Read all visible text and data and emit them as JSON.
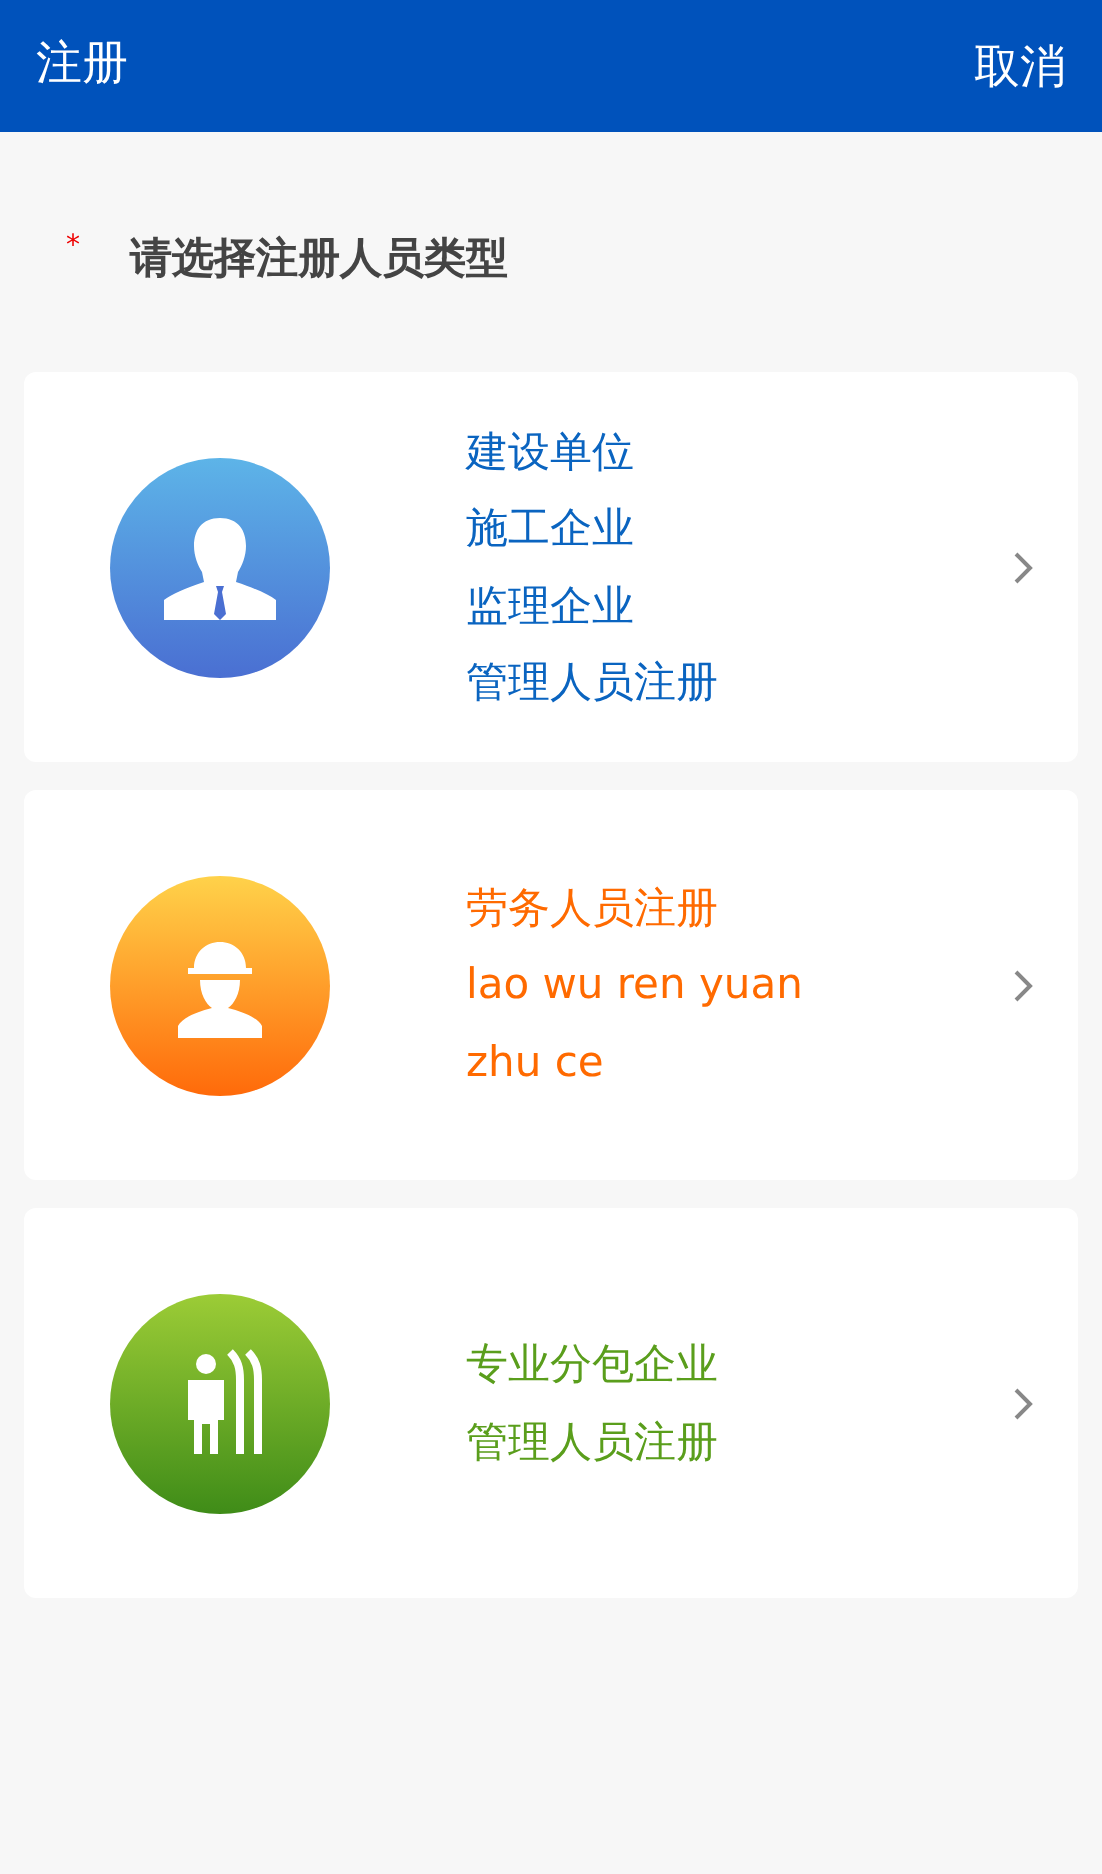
{
  "header": {
    "title": "注册",
    "action": "取消"
  },
  "prompt": {
    "required_mark": "*",
    "text": "请选择注册人员类型"
  },
  "cards": [
    {
      "kind": "manager",
      "color": "#0a64c0",
      "lines": [
        "建设单位",
        "施工企业",
        "监理企业",
        "管理人员注册"
      ]
    },
    {
      "kind": "worker",
      "color": "#ff6a00",
      "lines": [
        "劳务人员注册",
        "lao wu ren yuan",
        "zhu ce"
      ]
    },
    {
      "kind": "subcontractor",
      "color": "#5a9e1c",
      "lines": [
        "专业分包企业",
        "管理人员注册"
      ]
    }
  ]
}
